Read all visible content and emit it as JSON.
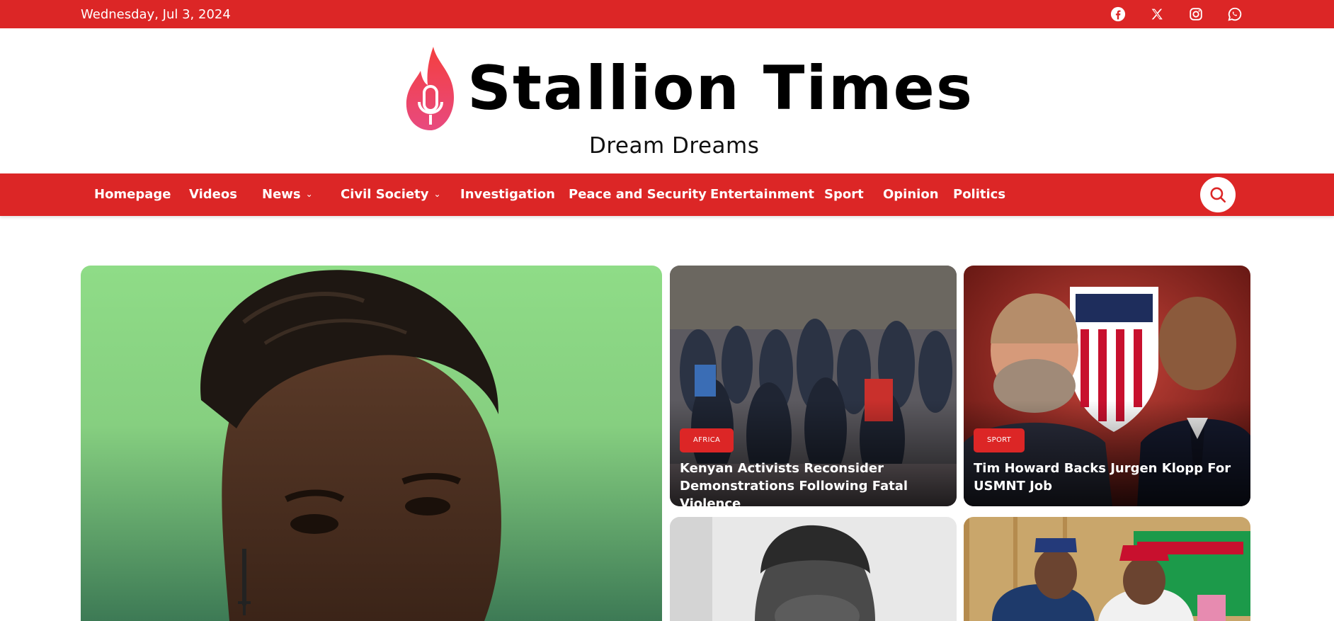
{
  "topbar": {
    "date": "Wednesday, Jul 3, 2024",
    "social": [
      {
        "name": "facebook-icon"
      },
      {
        "name": "x-twitter-icon"
      },
      {
        "name": "instagram-icon"
      },
      {
        "name": "whatsapp-icon"
      }
    ]
  },
  "brand": {
    "title": "Stallion Times",
    "tagline": "Dream Dreams",
    "logo_icon": "flame-microphone-icon",
    "accent_color": "#dc2626"
  },
  "nav": {
    "items": [
      {
        "label": "Homepage",
        "has_dropdown": false
      },
      {
        "label": "Videos",
        "has_dropdown": false
      },
      {
        "label": "News",
        "has_dropdown": true
      },
      {
        "label": "Civil Society",
        "has_dropdown": true
      },
      {
        "label": "Investigation",
        "has_dropdown": false
      },
      {
        "label": "Peace and Security",
        "has_dropdown": false
      },
      {
        "label": "Entertainment",
        "has_dropdown": false
      },
      {
        "label": "Sport",
        "has_dropdown": false
      },
      {
        "label": "Opinion",
        "has_dropdown": false
      },
      {
        "label": "Politics",
        "has_dropdown": false
      }
    ],
    "search_icon": "search-icon"
  },
  "feature": {
    "image": "portrait of young man on green background"
  },
  "grid": [
    {
      "category": "AFRICA",
      "title": "Kenyan Activists Reconsider Demonstrations Following Fatal Violence"
    },
    {
      "category": "SPORT",
      "title": "Tim Howard Backs Jurgen Klopp For USMNT Job"
    }
  ]
}
